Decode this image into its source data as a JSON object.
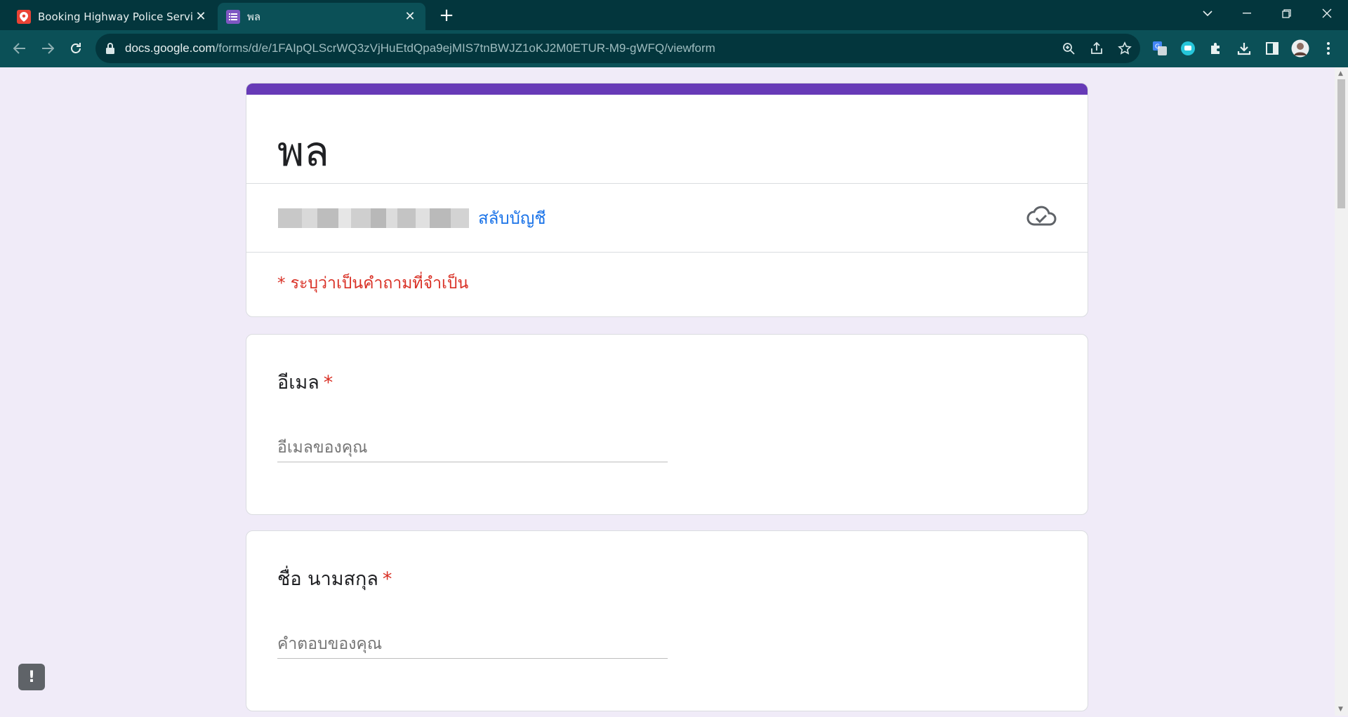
{
  "browser": {
    "tabs": [
      {
        "title": "Booking Highway Police Service /",
        "favicon": "map-pin-icon",
        "color": "#ea4335"
      },
      {
        "title": "พล",
        "favicon": "forms-icon",
        "color": "#7e57c2"
      }
    ],
    "url_host": "docs.google.com",
    "url_path": "/forms/d/e/1FAIpQLScrWQ3zVjHuEtdQpa9ejMIS7tnBWJZ1oKJ2M0ETUR-M9-gWFQ/viewform"
  },
  "form": {
    "title": "พล",
    "switch_account": "สลับบัญชี",
    "required_note": "* ระบุว่าเป็นคำถามที่จำเป็น",
    "accent_color": "#673ab7",
    "questions": [
      {
        "label": "อีเมล",
        "required": "*",
        "placeholder": "อีเมลของคุณ"
      },
      {
        "label": "ชื่อ นามสกุล",
        "required": "*",
        "placeholder": "คำตอบของคุณ"
      }
    ]
  },
  "feedback": {
    "icon": "report-icon",
    "glyph": "!"
  }
}
